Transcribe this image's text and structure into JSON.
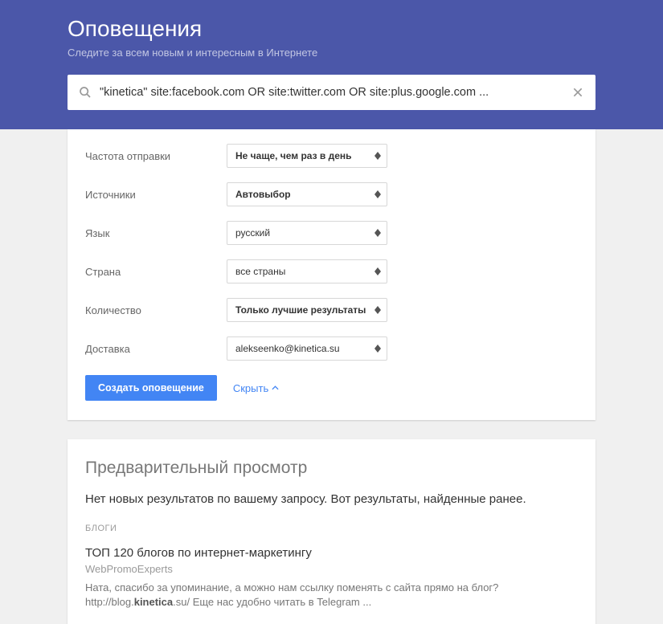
{
  "header": {
    "title": "Оповещения",
    "subtitle": "Следите за всем новым и интересным в Интернете",
    "search_value": "\"kinetica\" site:facebook.com OR site:twitter.com OR site:plus.google.com ..."
  },
  "settings": {
    "rows": [
      {
        "label": "Частота отправки",
        "value": "Не чаще, чем раз в день",
        "bold": true
      },
      {
        "label": "Источники",
        "value": "Автовыбор",
        "bold": true
      },
      {
        "label": "Язык",
        "value": "русский",
        "bold": false
      },
      {
        "label": "Страна",
        "value": "все страны",
        "bold": false
      },
      {
        "label": "Количество",
        "value": "Только лучшие результаты",
        "bold": true
      },
      {
        "label": "Доставка",
        "value": "alekseenko@kinetica.su",
        "bold": false
      }
    ],
    "create_label": "Создать оповещение",
    "hide_label": "Скрыть"
  },
  "preview": {
    "title": "Предварительный просмотр",
    "message": "Нет новых результатов по вашему запросу. Вот результаты, найденные ранее.",
    "section": "БЛОГИ",
    "result": {
      "title": "ТОП 120 блогов по интернет-маркетингу",
      "source": "WebPromoExperts",
      "snippet": "Ната, спасибо за упоминание, а можно нам ссылку поменять с сайта прямо на блог?",
      "url_prefix": "http://blog.",
      "url_bold": "kinetica",
      "url_suffix": ".su/ Еще нас удобно читать в Telegram ..."
    }
  }
}
